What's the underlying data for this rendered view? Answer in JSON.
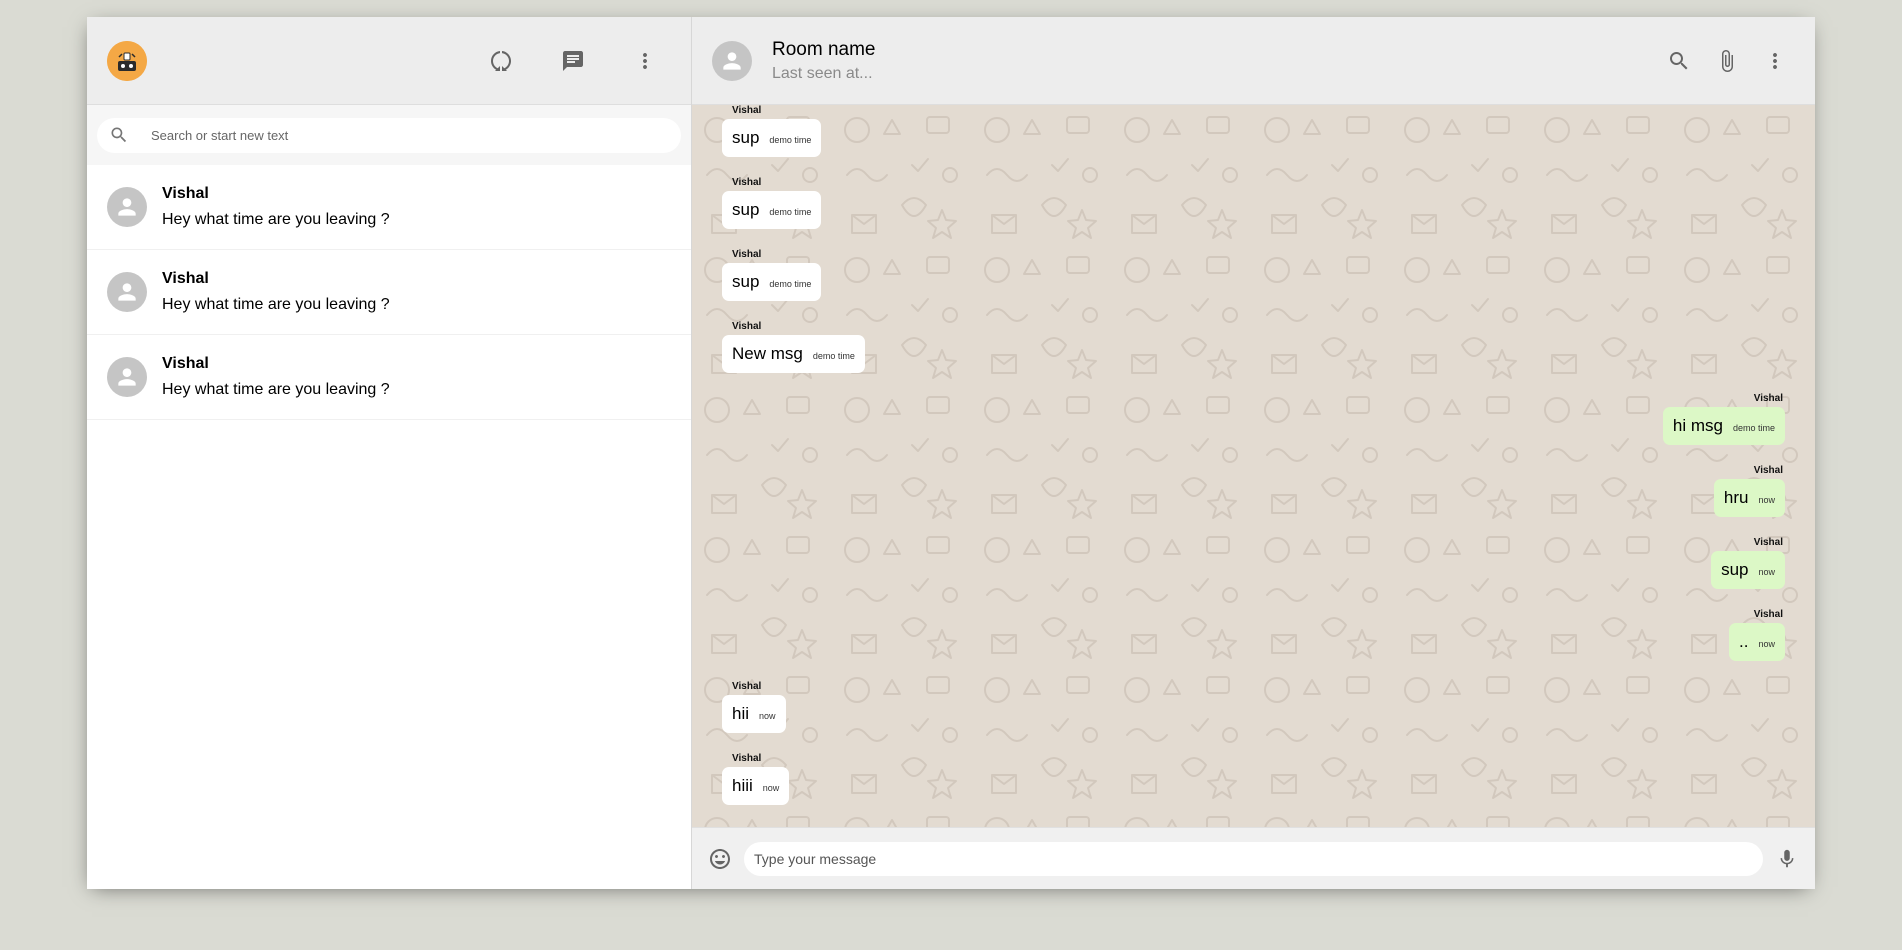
{
  "sidebar": {
    "search_placeholder": "Search or start new text",
    "chats": [
      {
        "name": "Vishal",
        "last_message": "Hey what time are you leaving ?"
      },
      {
        "name": "Vishal",
        "last_message": "Hey what time are you leaving ?"
      },
      {
        "name": "Vishal",
        "last_message": "Hey what time are you leaving ?"
      }
    ]
  },
  "chat": {
    "room_name": "Room name",
    "last_seen": "Last seen at...",
    "input_placeholder": "Type your message",
    "messages": [
      {
        "sender": "Vishal",
        "text": "sup",
        "time": "demo time",
        "sent": false
      },
      {
        "sender": "Vishal",
        "text": "sup",
        "time": "demo time",
        "sent": false
      },
      {
        "sender": "Vishal",
        "text": "sup",
        "time": "demo time",
        "sent": false
      },
      {
        "sender": "Vishal",
        "text": "New msg",
        "time": "demo time",
        "sent": false
      },
      {
        "sender": "Vishal",
        "text": "hi msg",
        "time": "demo time",
        "sent": true
      },
      {
        "sender": "Vishal",
        "text": "hru",
        "time": "now",
        "sent": true
      },
      {
        "sender": "Vishal",
        "text": "sup",
        "time": "now",
        "sent": true
      },
      {
        "sender": "Vishal",
        "text": "..",
        "time": "now",
        "sent": true
      },
      {
        "sender": "Vishal",
        "text": "hii",
        "time": "now",
        "sent": false
      },
      {
        "sender": "Vishal",
        "text": "hiii",
        "time": "now",
        "sent": false
      }
    ]
  },
  "icons": {
    "status": "status-ring-icon",
    "new_chat": "chat-icon",
    "menu": "more-vert-icon",
    "search": "search-icon",
    "attach": "attach-icon",
    "emoji": "emoji-icon",
    "mic": "mic-icon"
  },
  "colors": {
    "accent_avatar": "#f4a845",
    "sent_bubble": "#dcf8c6",
    "received_bubble": "#ffffff",
    "chat_background": "#e3dbd1",
    "header_background": "#ededed"
  }
}
